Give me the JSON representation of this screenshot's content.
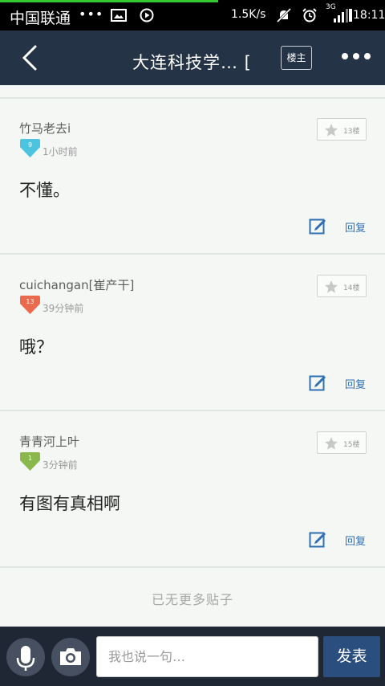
{
  "status_bar": {
    "carrier": "中国联通",
    "dots": "•••",
    "speed": "1.5K/s",
    "network": "3G",
    "time": "18:11"
  },
  "header": {
    "title": "大连科技学… [",
    "louzhu_label": "楼主"
  },
  "posts": [
    {
      "user": "竹马老去i",
      "level": "9",
      "level_color": "#4dc4df",
      "time": "1小时前",
      "floor": "13楼",
      "content": "不懂。",
      "reply": "回复"
    },
    {
      "user": "cuichangan[崔产干]",
      "level": "13",
      "level_color": "#ea6a4e",
      "time": "39分钟前",
      "floor": "14楼",
      "content": "哦？",
      "reply": "回复"
    },
    {
      "user": "青青河上叶",
      "level": "1",
      "level_color": "#8ab84a",
      "time": "3分钟前",
      "floor": "15楼",
      "content": "有图有真相啊",
      "reply": "回复"
    }
  ],
  "footer_note": "已无更多贴子",
  "bottom_bar": {
    "input_placeholder": "我也说一句…",
    "send_label": "发表"
  },
  "colors": {
    "header_bg": "#253346",
    "bottom_bg": "#1f2734",
    "reply_blue": "#2e6fb3",
    "send_bg": "#2a4f7e"
  },
  "icons": [
    "image-icon",
    "play-icon",
    "mute-icon",
    "alarm-icon",
    "signal-icon",
    "battery-icon",
    "back-icon",
    "more-icon",
    "star-icon",
    "edit-icon",
    "microphone-icon",
    "camera-icon"
  ]
}
